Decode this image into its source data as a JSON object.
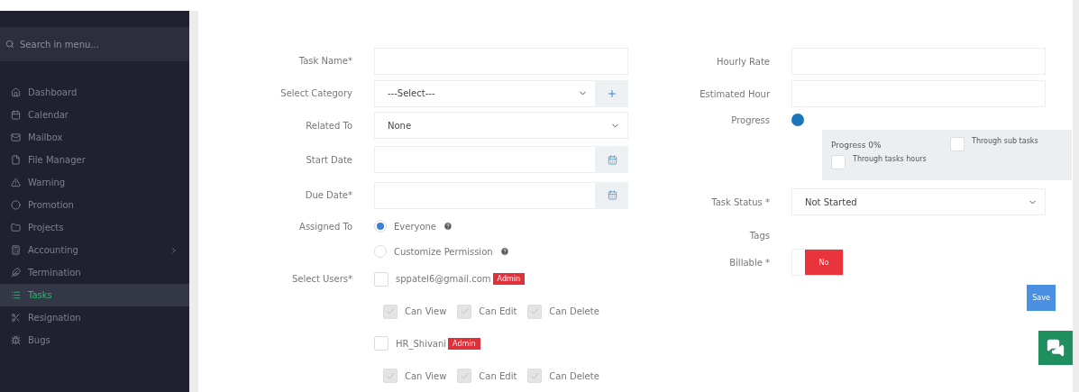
{
  "sidebar": {
    "search": {
      "placeholder": "Search in menu..."
    },
    "items": [
      {
        "label": "Dashboard",
        "selected": false
      },
      {
        "label": "Calendar",
        "selected": false
      },
      {
        "label": "Mailbox",
        "selected": false
      },
      {
        "label": "File Manager",
        "selected": false
      },
      {
        "label": "Warning",
        "selected": false
      },
      {
        "label": "Promotion",
        "selected": false
      },
      {
        "label": "Projects",
        "selected": false
      },
      {
        "label": "Accounting",
        "selected": false,
        "has_submenu": true
      },
      {
        "label": "Termination",
        "selected": false
      },
      {
        "label": "Tasks",
        "selected": true
      },
      {
        "label": "Resignation",
        "selected": false
      },
      {
        "label": "Bugs",
        "selected": false
      }
    ]
  },
  "left_fields": [
    {
      "label": "Task Name*",
      "kind": "text"
    },
    {
      "label": "Select Category",
      "kind": "select",
      "value": "---Select---",
      "add_button": true
    },
    {
      "label": "Related To",
      "kind": "select",
      "value": "None"
    },
    {
      "label": "Start Date",
      "kind": "date"
    },
    {
      "label": "Due Date*",
      "kind": "date"
    }
  ],
  "assigned_to": {
    "label": "Assigned To",
    "options": [
      {
        "label": "Everyone",
        "selected": true
      },
      {
        "label": "Customize Permission",
        "selected": false
      }
    ]
  },
  "select_users": {
    "label": "Select Users*",
    "users": [
      {
        "name": "sppatel6@gmail.com",
        "badge": "Admin",
        "checked": false,
        "permissions": [
          {
            "label": "Can View",
            "checked": true,
            "disabled": true
          },
          {
            "label": "Can Edit",
            "checked": true,
            "disabled": true
          },
          {
            "label": "Can Delete",
            "checked": true,
            "disabled": true
          }
        ]
      },
      {
        "name": "HR_Shivani",
        "badge": "Admin",
        "checked": false,
        "permissions": [
          {
            "label": "Can View",
            "checked": true,
            "disabled": true
          },
          {
            "label": "Can Edit",
            "checked": true,
            "disabled": true
          },
          {
            "label": "Can Delete",
            "checked": true,
            "disabled": true
          }
        ]
      }
    ]
  },
  "right_fields": [
    {
      "label": "Hourly Rate",
      "kind": "text"
    },
    {
      "label": "Estimated Hour",
      "kind": "text"
    }
  ],
  "progress": {
    "label": "Progress",
    "level": 0,
    "text": "Progress 0%",
    "options": [
      {
        "label": "Through sub tasks",
        "checked": false
      },
      {
        "label": "Through tasks hours",
        "checked": false
      }
    ]
  },
  "task_status": {
    "label": "Task Status *",
    "value": "Not Started"
  },
  "tags": {
    "label": "Tags"
  },
  "billable": {
    "label": "Billable *",
    "on": false,
    "state_text": "No"
  },
  "save_button": "Save"
}
